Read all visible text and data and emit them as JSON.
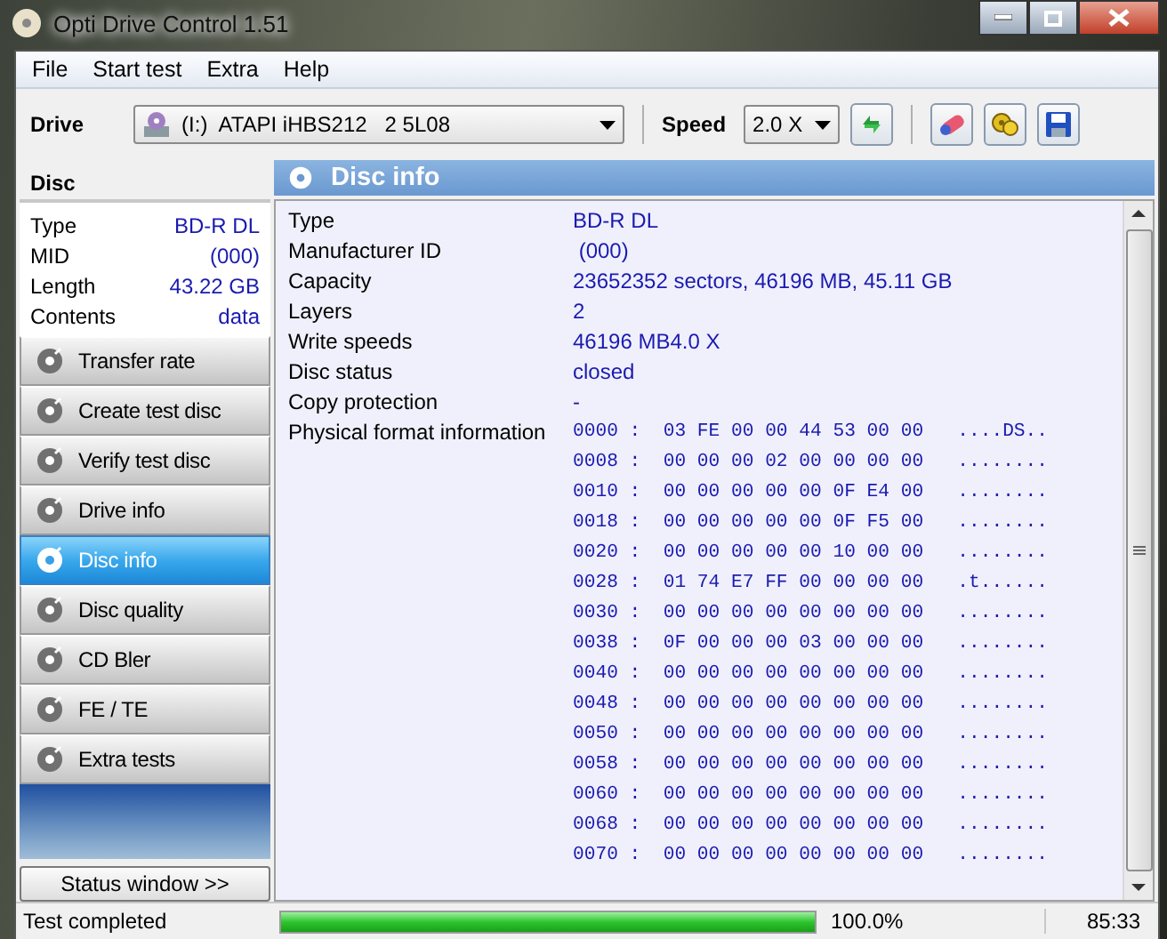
{
  "window": {
    "title": "Opti Drive Control 1.51"
  },
  "menu": [
    "File",
    "Start test",
    "Extra",
    "Help"
  ],
  "toolbar": {
    "drive_label": "Drive",
    "drive_letter": "(I:)",
    "drive_name": "ATAPI iHBS212   2 5L08",
    "speed_label": "Speed",
    "speed": "2.0 X"
  },
  "sidebar": {
    "title": "Disc",
    "properties": [
      {
        "label": "Type",
        "value": "BD-R DL"
      },
      {
        "label": "MID",
        "value": "(000)"
      },
      {
        "label": "Length",
        "value": "43.22 GB"
      },
      {
        "label": "Contents",
        "value": "data"
      }
    ],
    "nav": [
      {
        "label": "Transfer rate",
        "selected": false
      },
      {
        "label": "Create test disc",
        "selected": false
      },
      {
        "label": "Verify test disc",
        "selected": false
      },
      {
        "label": "Drive info",
        "selected": false
      },
      {
        "label": "Disc info",
        "selected": true
      },
      {
        "label": "Disc quality",
        "selected": false
      },
      {
        "label": "CD Bler",
        "selected": false
      },
      {
        "label": "FE / TE",
        "selected": false
      },
      {
        "label": "Extra tests",
        "selected": false
      }
    ],
    "status_button": "Status window >>"
  },
  "panel": {
    "title": "Disc info",
    "fields": [
      {
        "kind": "text",
        "label": "Type",
        "value": "BD-R DL"
      },
      {
        "kind": "text",
        "label": "Manufacturer ID",
        "value": " (000)"
      },
      {
        "kind": "text",
        "label": "Capacity",
        "value": "23652352 sectors, 46196 MB, 45.11 GB"
      },
      {
        "kind": "text",
        "label": "Layers",
        "value": "2"
      },
      {
        "kind": "text",
        "label": "Write speeds",
        "value": "46196 MB4.0 X"
      },
      {
        "kind": "text",
        "label": "Disc status",
        "value": "closed"
      },
      {
        "kind": "text",
        "label": "Copy protection",
        "value": "-"
      },
      {
        "kind": "hex",
        "label": "Physical format information",
        "lines": [
          "0000 :  03 FE 00 00 44 53 00 00   ....DS..",
          "0008 :  00 00 00 02 00 00 00 00   ........",
          "0010 :  00 00 00 00 00 0F E4 00   ........",
          "0018 :  00 00 00 00 00 0F F5 00   ........",
          "0020 :  00 00 00 00 00 10 00 00   ........",
          "0028 :  01 74 E7 FF 00 00 00 00   .t......",
          "0030 :  00 00 00 00 00 00 00 00   ........",
          "0038 :  0F 00 00 00 03 00 00 00   ........",
          "0040 :  00 00 00 00 00 00 00 00   ........",
          "0048 :  00 00 00 00 00 00 00 00   ........",
          "0050 :  00 00 00 00 00 00 00 00   ........",
          "0058 :  00 00 00 00 00 00 00 00   ........",
          "0060 :  00 00 00 00 00 00 00 00   ........",
          "0068 :  00 00 00 00 00 00 00 00   ........",
          "0070 :  00 00 00 00 00 00 00 00   ........"
        ]
      }
    ]
  },
  "status_bar": {
    "message": "Test completed",
    "progress": {
      "level": 1.0
    },
    "percent": "100.0%",
    "time": "85:33"
  }
}
